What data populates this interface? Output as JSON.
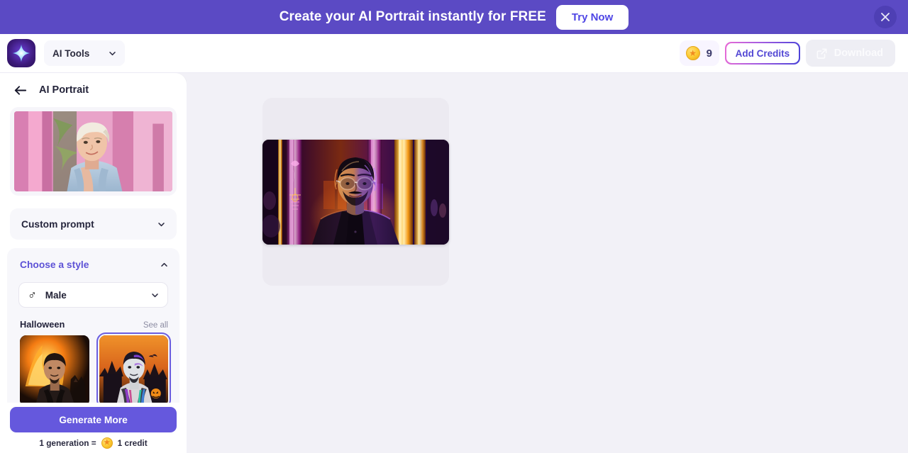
{
  "banner": {
    "text": "Create your AI Portrait instantly for FREE",
    "cta_label": "Try Now",
    "close_icon": "close-icon",
    "bg_color": "#5b4ac4"
  },
  "header": {
    "logo_icon": "app-logo-sparkle-icon",
    "tools_dropdown": {
      "label": "AI Tools",
      "chevron_icon": "chevron-down-icon"
    },
    "credits": {
      "coin_icon": "coin-icon",
      "count": "9"
    },
    "add_credits_label": "Add Credits",
    "download": {
      "label": "Download",
      "icon": "external-link-icon",
      "disabled": true
    }
  },
  "sidebar": {
    "back_icon": "back-arrow-icon",
    "title": "AI Portrait",
    "source_image_alt": "uploaded-source-portrait",
    "custom_prompt": {
      "label": "Custom prompt",
      "chevron_icon": "chevron-down-icon",
      "expanded": false
    },
    "choose_style": {
      "label": "Choose a style",
      "chevron_icon": "chevron-up-icon",
      "expanded": true,
      "accent_color": "#5d52d6"
    },
    "gender_select": {
      "symbol": "♂",
      "value": "Male",
      "chevron_icon": "chevron-down-icon"
    },
    "category": {
      "title": "Halloween",
      "see_all_label": "See all"
    },
    "style_thumbnails": [
      {
        "name": "halloween-fire-style",
        "selected": false
      },
      {
        "name": "halloween-haunted-style",
        "selected": true
      }
    ],
    "generate": {
      "button_label": "Generate More",
      "note_prefix": "1 generation =",
      "note_suffix": "1 credit",
      "coin_icon": "coin-icon"
    }
  },
  "main": {
    "result_image_alt": "generated-neon-portrait"
  }
}
